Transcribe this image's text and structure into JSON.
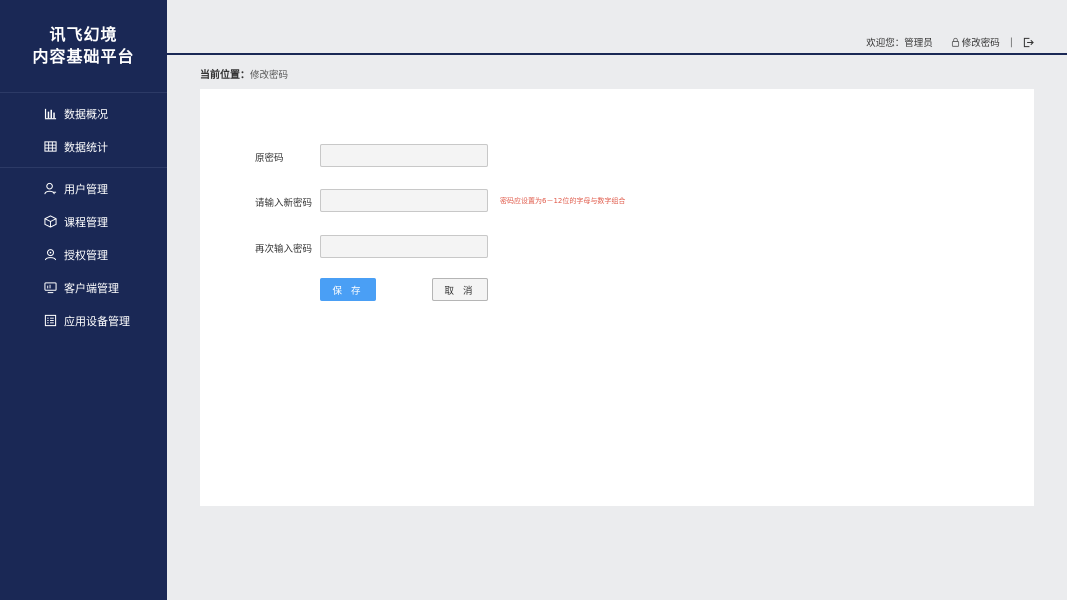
{
  "brand": {
    "line1": "讯飞幻境",
    "line2": "内容基础平台"
  },
  "nav": {
    "group1": [
      {
        "label": "数据概况",
        "icon": "bar-chart-icon"
      },
      {
        "label": "数据统计",
        "icon": "table-icon"
      }
    ],
    "group2": [
      {
        "label": "用户管理",
        "icon": "user-icon"
      },
      {
        "label": "课程管理",
        "icon": "cube-icon"
      },
      {
        "label": "授权管理",
        "icon": "authorize-icon"
      },
      {
        "label": "客户端管理",
        "icon": "monitor-icon"
      },
      {
        "label": "应用设备管理",
        "icon": "device-list-icon"
      }
    ]
  },
  "header": {
    "welcome": "欢迎您：管理员",
    "change_password": "修改密码",
    "separator": "|"
  },
  "breadcrumb": {
    "label": "当前位置：",
    "current": "修改密码"
  },
  "form": {
    "old_password_label": "原密码",
    "new_password_label": "请输入新密码",
    "new_password_hint": "密码应设置为6－12位的字母与数字组合",
    "confirm_password_label": "再次输入密码",
    "save_label": "保 存",
    "cancel_label": "取 消"
  },
  "colors": {
    "sidebar_bg": "#1a2855",
    "primary_button": "#4a9ff5",
    "hint_text": "#e05b4b",
    "page_bg": "#ebecee"
  }
}
